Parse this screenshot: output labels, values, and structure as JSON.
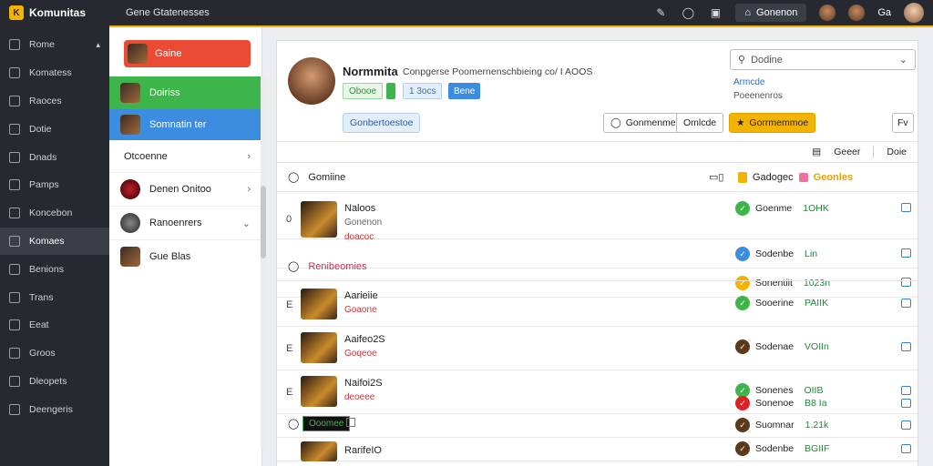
{
  "topbar": {
    "logo_text": "Komunitas",
    "title": "Gene Gtatenesses",
    "user_button": "Gonenon",
    "user_name": "Ga",
    "icons": [
      "edit-icon",
      "chat-icon",
      "window-icon"
    ]
  },
  "sidebar": {
    "items": [
      {
        "label": "Rome",
        "active": false
      },
      {
        "label": "Komatess",
        "active": false
      },
      {
        "label": "Raoces",
        "active": false
      },
      {
        "label": "Dotie",
        "active": false
      },
      {
        "label": "Dnads",
        "active": false
      },
      {
        "label": "Pamps",
        "active": false
      },
      {
        "label": "Koncebon",
        "active": false
      },
      {
        "label": "Komaes",
        "active": true
      },
      {
        "label": "Benions",
        "active": false
      },
      {
        "label": "Trans",
        "active": false
      },
      {
        "label": "Eeat",
        "active": false
      },
      {
        "label": "Groos",
        "active": false
      },
      {
        "label": "Dleopets",
        "active": false
      },
      {
        "label": "Deengeris",
        "active": false
      }
    ]
  },
  "panel": {
    "red_button": "Gaine",
    "green_button": "Doiriss",
    "blue_button": "Somnatin ter",
    "items": [
      {
        "label": "Otcoenne"
      },
      {
        "label": "Denen Onitoo"
      },
      {
        "label": "Ranoenrers"
      },
      {
        "label": "Gue Blas"
      }
    ]
  },
  "profile": {
    "name": "Normmita",
    "description": "Conpgerse Poomernenschbieing co/ I AOOS",
    "tags": [
      "Obooe",
      "1 3ocs",
      "Bene"
    ],
    "select_placeholder": "Dodine",
    "meta_1": "Armcde",
    "meta_2": "Poeenenros",
    "buttons": {
      "b1": "Gonbertoestoe",
      "b2": "Gonmenme",
      "b3": "Omlcde",
      "b4": "Gorrmemmoe",
      "b5": "Fv"
    }
  },
  "toolbar": {
    "item1": "Geeer",
    "item2": "Doie"
  },
  "section1": {
    "title": "Gomiine",
    "right_label": "Gadogec",
    "right_accent": "Geonles"
  },
  "rows": [
    {
      "num": "0",
      "title": "Naloos",
      "sub1": "Gonenon",
      "sub2": "doacoc",
      "stat": "Goenme",
      "val": "1OHK",
      "status": "green"
    },
    {
      "num": "",
      "title": "",
      "sub1": "",
      "sub2": "",
      "stat": "Sodenbe",
      "val": "Lin",
      "status": "blue"
    },
    {
      "num": "",
      "title": "",
      "sub1": "",
      "sub2": "",
      "stat": "Sonentiit",
      "val": "1023n",
      "status": "yellow"
    }
  ],
  "section2": {
    "title": "Renibeomies"
  },
  "rows2": [
    {
      "num": "E",
      "title": "Aarieiie",
      "sub": "Goaone",
      "stat": "Sooerine",
      "val": "PAIIK",
      "status": "green"
    },
    {
      "num": "E",
      "title": "Aaifeo2S",
      "sub": "Goqeoe",
      "stat": "Sodenae",
      "val": "VOIIn",
      "status": "dark"
    },
    {
      "num": "E",
      "title": "Naifoi2S",
      "sub": "deoeee",
      "stat": "Sonenes",
      "val": "OIIB",
      "status": "green"
    },
    {
      "num": "",
      "title": "",
      "sub": "",
      "stat": "Sonenoe",
      "val": "B8 Ia",
      "status": "red"
    },
    {
      "num": "",
      "title": "Ooomee",
      "sub": "",
      "stat": "Suomnar",
      "val": "1.21k",
      "status": "dark"
    },
    {
      "num": "",
      "title": "RarifeIO",
      "sub": "",
      "stat": "Sodenbe",
      "val": "BGIIF",
      "status": "dark"
    }
  ],
  "colors": {
    "accent": "#f5b301",
    "red": "#e94b35",
    "green": "#3db54a",
    "blue": "#3c8de0"
  }
}
